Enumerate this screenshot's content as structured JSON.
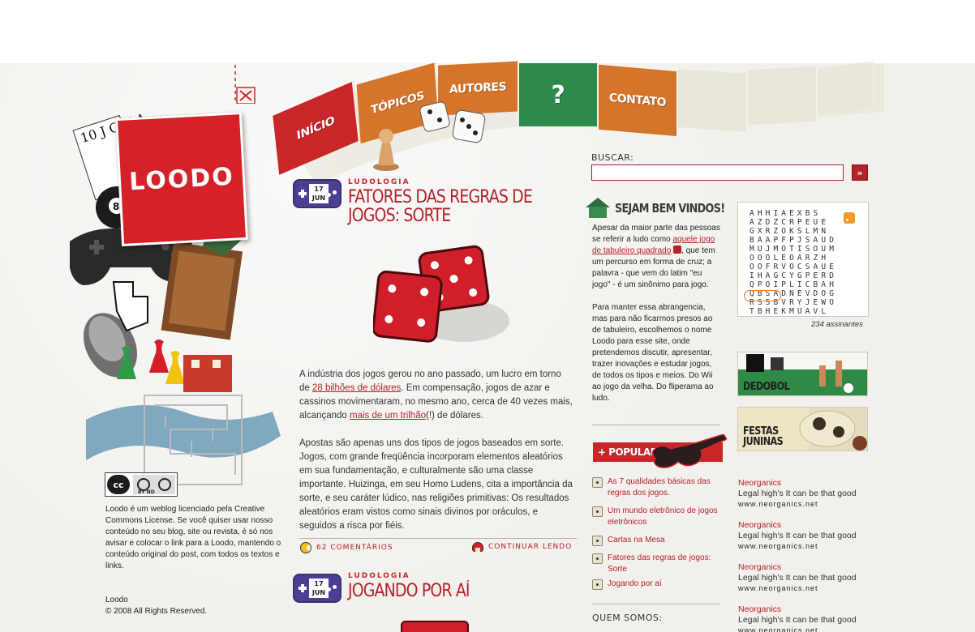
{
  "nav": {
    "items": [
      "INÍCIO",
      "TÓPICOS",
      "AUTORES",
      "?",
      "CONTATO"
    ]
  },
  "brand": {
    "logo_text": "LOODO",
    "colors": {
      "red": "#c9262a",
      "orange": "#d4752b",
      "green": "#2e8a4c",
      "purple": "#4a3f93"
    }
  },
  "posts": [
    {
      "day": "17",
      "month": "JUN",
      "category": "LUDOLOGIA",
      "title_lines": [
        "FATORES DAS REGRAS DE",
        "JOGOS: SORTE"
      ],
      "p1_a": "A indústria dos jogos gerou no ano passado, um lucro em torno de ",
      "p1_link1": "28 bilhões de dólares",
      "p1_b": ". Em compensação, jogos de azar e cassinos movimentaram, no mesmo ano, cerca de 40 vezes mais, alcançando ",
      "p1_link2": "mais de um trilhão",
      "p1_c": "(!) de dólares.",
      "p2": "Apostas são apenas uns dos tipos de jogos baseados em sorte. Jogos, com grande freqüência incorporam elementos aleatórios em sua fundamentação, e culturalmente são uma classe importante. Huizinga, em seu Homo Ludens, cita a importância da sorte, e seu caráter lúdico, nas religiões primitivas: Os resultados aleatórios eram vistos como sinais divinos por oráculos, e seguidos a risca por fiéis.",
      "comments": "62 COMENTÁRIOS",
      "read_more": "CONTINUAR LENDO"
    },
    {
      "day": "17",
      "month": "JUN",
      "category": "LUDOLOGIA",
      "title": "JOGANDO POR AÍ"
    }
  ],
  "search": {
    "label": "BUSCAR:",
    "value": "",
    "button": "»"
  },
  "welcome": {
    "title": "SEJAM BEM VINDOS!",
    "p1_a": "Apesar da maior parte das pessoas se referir a ludo como ",
    "p1_link": "aquele jogo de tabuleiro quadrado",
    "p1_b": ", que tem um percurso em forma de cruz; a palavra - que vem do latim \"eu jogo\" - é um sinônimo para jogo.",
    "p2": "Para manter essa abrangencia, mas para não ficarmos presos ao de tabuleiro, escolhemos o nome Loodo para esse site, onde pretendemos discutir, apresentar, trazer inovações e estudar jogos, de todos os tipos e meios. Do Wii ao jogo da velha. Do fliperama ao ludo."
  },
  "populares": {
    "title": "+ POPULARES:",
    "items": [
      "As 7 qualidades básicas das regras dos jogos.",
      "Um mundo eletrônico de jogos eletrônicos",
      "Cartas na Mesa",
      "Fatores das regras de jogos: Sorte",
      "Jogando por aí"
    ]
  },
  "quem_somos": "QUEM SOMOS:",
  "rss": {
    "grid": "AHHIAEXBS\nAZDZCRPEUE\nGXRZOKSLMN\nBAAPFPJSAUD\nMUJMOTISOUM\nOOOLEOARZH\nOOFRVOCSAUE\nIHAGCYGPERD\nQPOIPLICBAH\nQBSADNEVDOG\nRSSBVRYJEWO\nTBHEKMUAVL",
    "subscribers": "234 assinantes"
  },
  "banners": [
    "DEDOBOL",
    "FESTAS JUNINAS"
  ],
  "ads": [
    {
      "name": "Neorganics",
      "text": "Legal high's It can be that good",
      "url": "www.neorganics.net"
    },
    {
      "name": "Neorganics",
      "text": "Legal high's It can be that good",
      "url": "www.neorganics.net"
    },
    {
      "name": "Neorganics",
      "text": "Legal high's It can be that good",
      "url": "www.neorganics.net"
    },
    {
      "name": "Neorganics",
      "text": "Legal high's It can be that good",
      "url": "www.neorganics.net"
    }
  ],
  "license": {
    "badge": "cc",
    "badge_terms": "BY  ND",
    "text": "Loodo é um weblog licenciado pela Creative Commons License. Se você quiser usar nosso conteúdo no seu blog, site ou revista, é só nos avisar e colocar o link para a Loodo, mantendo o conteúdo original do post, com todos os textos e links."
  },
  "footer": {
    "line1": "Loodo",
    "line2": "© 2008 All Rights Reserved."
  }
}
